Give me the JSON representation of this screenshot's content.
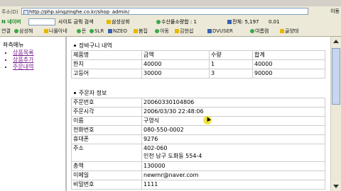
{
  "address_bar": {
    "label": "주소(D)",
    "url": "http://php.singzinghe.co.kr/shop_admin/",
    "go_label": "이동"
  },
  "toolbar": {
    "naver_label": "N 네이버",
    "search_site_label": "사이트 금뭐 검색",
    "shopping_label": "삼성상회",
    "shopping_feed_label": "수산물소량합 : 1",
    "total_label": "전체: 5,197",
    "value_label": "0.01"
  },
  "links_bar": {
    "label": "연결",
    "items": [
      "삼성해",
      "나몰아네",
      "돈",
      "SLR",
      "NZEO",
      "봄집",
      "야동",
      "김현섭",
      "DVUSER",
      "여름캠",
      "골양태"
    ]
  },
  "left_menu": {
    "title": "좌측메뉴",
    "items": [
      "상품목록",
      "상품추가",
      "주문내역"
    ]
  },
  "cart_section": {
    "title": "장바구니 내역",
    "headers": [
      "제품명",
      "금액",
      "수량",
      "합계"
    ],
    "rows": [
      [
        "한치",
        "40000",
        "1",
        "40000"
      ],
      [
        "고등어",
        "30000",
        "3",
        "90000"
      ]
    ]
  },
  "order_section": {
    "title": "주문자 정보",
    "rows": [
      {
        "label": "주문번호",
        "value": "20060330104806"
      },
      {
        "label": "주문시각",
        "value": "2006/03/30 22:48:06"
      },
      {
        "label": "이름",
        "value": "구영식"
      },
      {
        "label": "전화번호",
        "value": "080-550-0002"
      },
      {
        "label": "휴대폰",
        "value": "9276"
      },
      {
        "label": "주소",
        "value": "402-060\n인천 남구 도화동 554-4"
      },
      {
        "label": "총액",
        "value": "130000"
      },
      {
        "label": "이메일",
        "value": "newmr@naver.com"
      },
      {
        "label": "비밀번호",
        "value": "1111"
      }
    ]
  }
}
